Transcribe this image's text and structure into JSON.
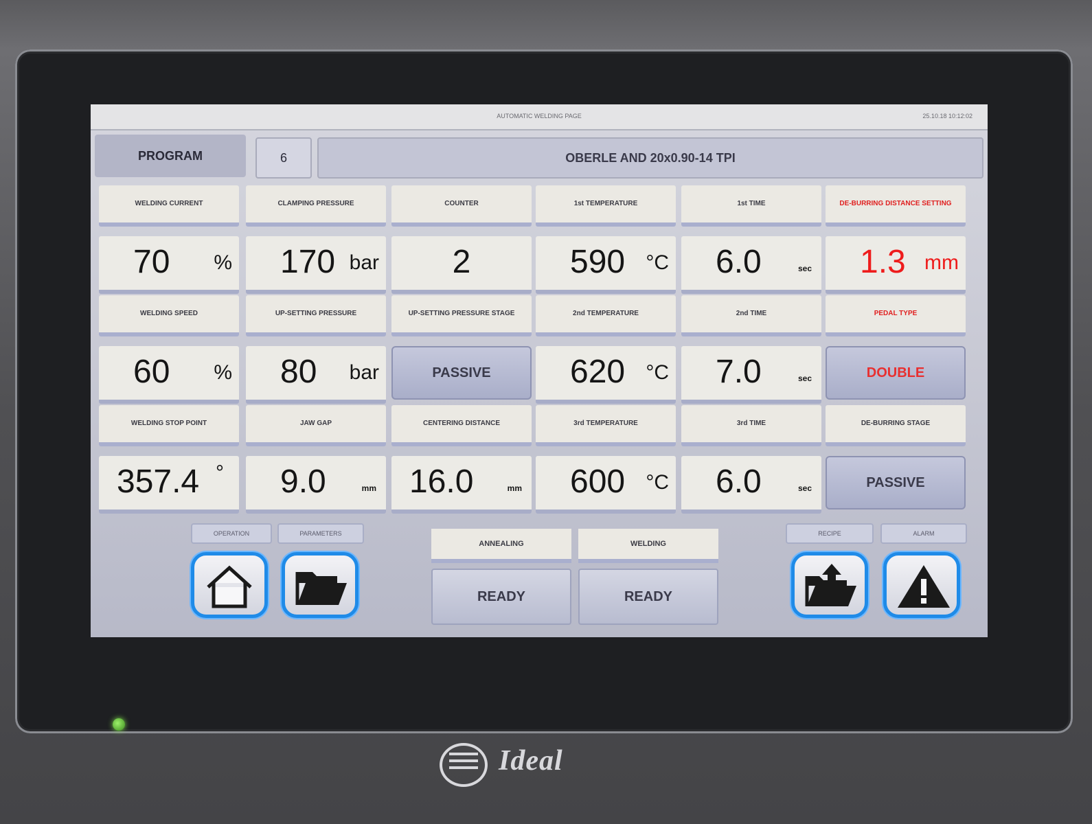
{
  "topbar": {
    "title": "AUTOMATIC WELDING PAGE",
    "clock": "25.10.18   10:12:02"
  },
  "program": {
    "label": "PROGRAM",
    "number": "6",
    "name": "OBERLE AND 20x0.90-14 TPI"
  },
  "rows": [
    [
      {
        "label": "WELDING CURRENT",
        "type": "value",
        "value": "70",
        "unit": "%",
        "unit_size": "big"
      },
      {
        "label": "CLAMPING PRESSURE",
        "type": "value",
        "value": "170",
        "unit": "bar",
        "unit_size": "big"
      },
      {
        "label": "COUNTER",
        "type": "value",
        "value": "2",
        "unit": "",
        "unit_size": "big",
        "center": true
      },
      {
        "label": "1st TEMPERATURE",
        "type": "value",
        "value": "590",
        "unit": "°C",
        "unit_size": "big"
      },
      {
        "label": "1st TIME",
        "type": "value",
        "value": "6.0",
        "unit": "sec",
        "unit_size": "small"
      },
      {
        "label": "DE-BURRING DISTANCE SETTING",
        "type": "value",
        "value": "1.3",
        "unit": "mm",
        "unit_size": "big",
        "red": true
      }
    ],
    [
      {
        "label": "WELDING SPEED",
        "type": "value",
        "value": "60",
        "unit": "%",
        "unit_size": "big"
      },
      {
        "label": "UP-SETTING PRESSURE",
        "type": "value",
        "value": "80",
        "unit": "bar",
        "unit_size": "big"
      },
      {
        "label": "UP-SETTING PRESSURE STAGE",
        "type": "button",
        "value": "PASSIVE"
      },
      {
        "label": "2nd TEMPERATURE",
        "type": "value",
        "value": "620",
        "unit": "°C",
        "unit_size": "big"
      },
      {
        "label": "2nd TIME",
        "type": "value",
        "value": "7.0",
        "unit": "sec",
        "unit_size": "small"
      },
      {
        "label": "PEDAL TYPE",
        "type": "button",
        "value": "DOUBLE",
        "red": true
      }
    ],
    [
      {
        "label": "WELDING STOP POINT",
        "type": "value",
        "value": "357.4",
        "unit": "°",
        "unit_size": "big"
      },
      {
        "label": "JAW GAP",
        "type": "value",
        "value": "9.0",
        "unit": "mm",
        "unit_size": "small"
      },
      {
        "label": "CENTERING DISTANCE",
        "type": "value",
        "value": "16.0",
        "unit": "mm",
        "unit_size": "small"
      },
      {
        "label": "3rd TEMPERATURE",
        "type": "value",
        "value": "600",
        "unit": "°C",
        "unit_size": "big"
      },
      {
        "label": "3rd TIME",
        "type": "value",
        "value": "6.0",
        "unit": "sec",
        "unit_size": "small"
      },
      {
        "label": "DE-BURRING STAGE",
        "type": "button",
        "value": "PASSIVE"
      }
    ]
  ],
  "bottom": {
    "tabs": [
      "OPERATION",
      "PARAMETERS",
      "RECIPE",
      "ALARM"
    ],
    "annealing_label": "ANNEALING",
    "annealing_status": "READY",
    "welding_label": "WELDING",
    "welding_status": "READY"
  },
  "icons": [
    "home-icon",
    "folder-open-icon",
    "folder-upload-icon",
    "warning-icon"
  ],
  "brand": {
    "name": "Ideal"
  },
  "colors": {
    "accent": "#1f8be8",
    "alert": "#ee1c1c",
    "led": "#7ddb4a"
  }
}
